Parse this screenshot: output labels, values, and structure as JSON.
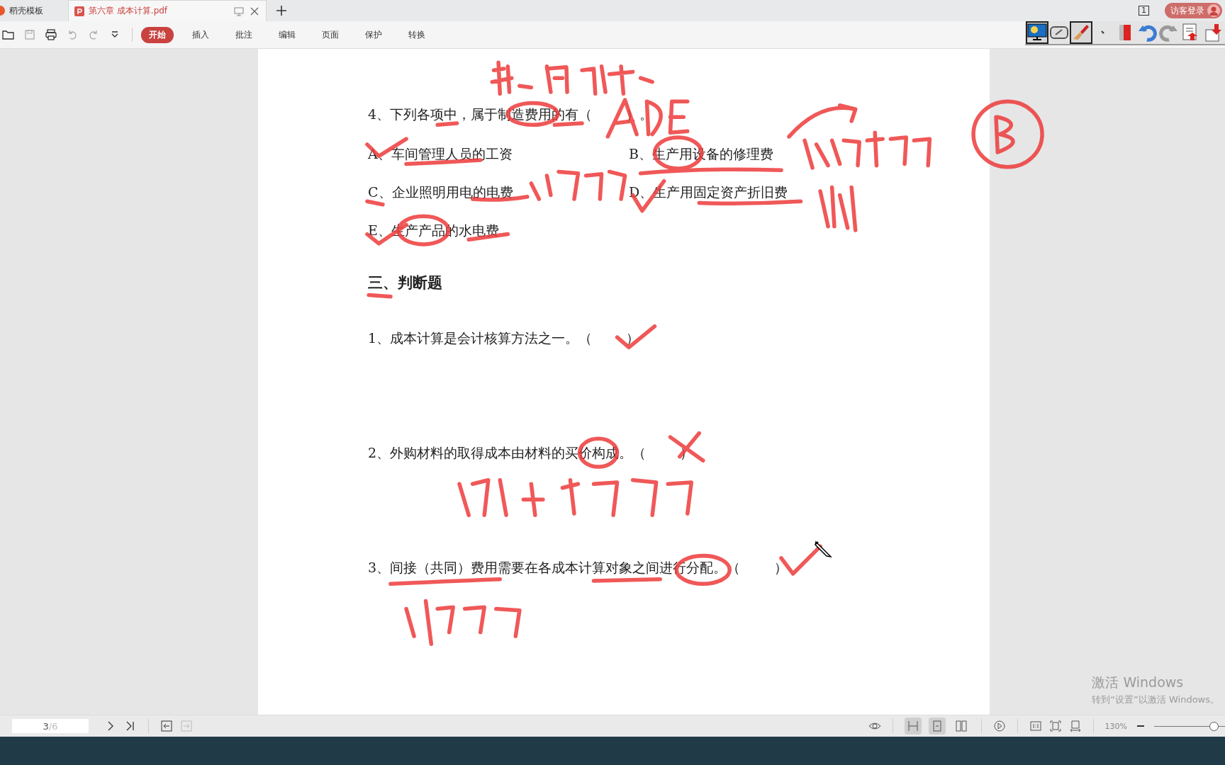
{
  "tabs": [
    {
      "label": "稻壳模板",
      "kind": "template",
      "selected": false
    },
    {
      "label": "第六章 成本计算.pdf",
      "kind": "pdf",
      "selected": true
    }
  ],
  "tab_count": "1",
  "login_button": {
    "label": "访客登录"
  },
  "menu": [
    {
      "label": "开始",
      "selected": true
    },
    {
      "label": "插入",
      "selected": false
    },
    {
      "label": "批注",
      "selected": false
    },
    {
      "label": "编辑",
      "selected": false
    },
    {
      "label": "页面",
      "selected": false
    },
    {
      "label": "保护",
      "selected": false
    },
    {
      "label": "转换",
      "selected": false
    }
  ],
  "document": {
    "question": {
      "text": "4、下列各项中，属于制造费用的有（        ）。",
      "options": [
        "A、车间管理人员的工资",
        "B、生产用设备的修理费",
        "C、企业照明用电的电费",
        "D、生产用固定资产折旧费",
        "E、生产产品的水电费"
      ]
    },
    "section_heading": "三、判断题",
    "judgments": [
      "1、成本计算是会计核算方法之一。（        ）",
      "2、外购材料的取得成本由材料的买价构成。（        ）",
      "3、间接（共同）费用需要在各成本计算对象之间进行分配。（        ）"
    ]
  },
  "activation": {
    "title": "激活 Windows",
    "subtitle": "转到“设置”以激活 Windows。"
  },
  "status_bar": {
    "page_current": "3",
    "page_total": "/6",
    "view_modes": [
      {
        "kind": "scroll",
        "selected": true
      },
      {
        "kind": "single",
        "selected": true
      },
      {
        "kind": "double",
        "selected": false
      }
    ],
    "zoom_text": "130%",
    "zoom": {
      "level": 0.7
    }
  }
}
